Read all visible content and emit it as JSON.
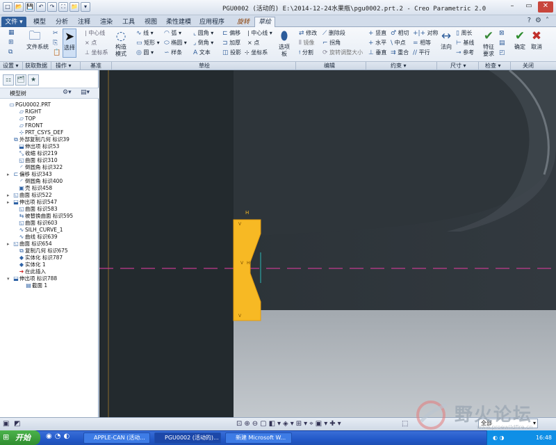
{
  "window": {
    "title": "PGU0002 (活动的) E:\\2014-12-24水果瓶\\pgu0002.prt.2 - Creo Parametric 2.0"
  },
  "quick_access": [
    "□",
    "📂",
    "💾",
    "↶",
    "↷",
    "⛶",
    "📁",
    "▾"
  ],
  "tabs": [
    {
      "label": "文件 ▾",
      "kind": "file"
    },
    {
      "label": "模型"
    },
    {
      "label": "分析"
    },
    {
      "label": "注释"
    },
    {
      "label": "渲染"
    },
    {
      "label": "工具"
    },
    {
      "label": "视图"
    },
    {
      "label": "柔性建模"
    },
    {
      "label": "应用程序"
    },
    {
      "label": "旋转",
      "kind": "ctx"
    },
    {
      "label": "草绘",
      "kind": "active"
    }
  ],
  "ribbon": {
    "setup": {
      "labels": [
        "设置 ▾"
      ]
    },
    "getdata": {
      "file_system": "文件系统",
      "group": "获取数据"
    },
    "operations": {
      "select": "选择",
      "group": "操作 ▾"
    },
    "datum": {
      "centerline": "中心线",
      "point": "点",
      "coordsys": "坐标系",
      "group": "基准"
    },
    "construction": {
      "label": "构造模式"
    },
    "sketch": {
      "line": "线",
      "arc": "弧",
      "fillet": "圆角",
      "offset": "偏移",
      "centerline": "中心线",
      "rectangle": "矩形",
      "ellipse": "椭圆",
      "chamfer": "倒角",
      "thicken": "加厚",
      "point": "点",
      "circle": "圆",
      "spline": "样条",
      "text": "文本",
      "project": "投影",
      "coordsys": "坐标系",
      "palette": "选项板",
      "group": "草绘"
    },
    "editing": {
      "modify": "修改",
      "delete_segment": "删除段",
      "mirror": "镜像",
      "corner": "拐角",
      "divide": "分割",
      "rotate_resize": "旋转调整大小",
      "group": "编辑"
    },
    "constrain": {
      "vertical": "竖直",
      "tangent": "相切",
      "symmetric": "对称",
      "horizontal": "水平",
      "midpoint": "中点",
      "equal": "相等",
      "perpendicular": "垂直",
      "coincident": "重合",
      "parallel": "平行",
      "group": "约束 ▾"
    },
    "dimension": {
      "normal": "法向",
      "perimeter": "周长",
      "baseline": "基线",
      "reference": "参考",
      "group": "尺寸 ▾"
    },
    "inspect": {
      "feature_req": "特征要求",
      "group": "检查 ▾"
    },
    "close": {
      "ok": "确定",
      "cancel": "取消",
      "group": "关闭"
    }
  },
  "model_tree": {
    "title": "模型树",
    "nodes": [
      {
        "label": "PGU0002.PRT",
        "icon": "part-icon",
        "expand": ""
      },
      {
        "label": "RIGHT",
        "icon": "datum-plane-icon",
        "expand": ""
      },
      {
        "label": "TOP",
        "icon": "datum-plane-icon",
        "expand": ""
      },
      {
        "label": "FRONT",
        "icon": "datum-plane-icon",
        "expand": ""
      },
      {
        "label": "PRT_CSYS_DEF",
        "icon": "csys-icon",
        "expand": ""
      },
      {
        "label": "外部复制几何 标识39",
        "icon": "copy-geom-icon",
        "expand": ""
      },
      {
        "label": "伸出项 标识53",
        "icon": "extrude-icon",
        "expand": ""
      },
      {
        "label": "收缩 标识219",
        "icon": "shrink-icon",
        "expand": ""
      },
      {
        "label": "曲面 标识310",
        "icon": "surface-icon",
        "expand": ""
      },
      {
        "label": "倒圆角 标识322",
        "icon": "round-icon",
        "expand": ""
      },
      {
        "label": "偏移 标识343",
        "icon": "offset-icon",
        "expand": "▸"
      },
      {
        "label": "倒圆角 标识400",
        "icon": "round-icon",
        "expand": ""
      },
      {
        "label": "壳 标识458",
        "icon": "shell-icon",
        "expand": ""
      },
      {
        "label": "曲面 标识522",
        "icon": "surface-icon",
        "expand": "▸"
      },
      {
        "label": "伸出项 标识547",
        "icon": "extrude-icon",
        "expand": "▸"
      },
      {
        "label": "曲面 标识583",
        "icon": "surface-icon",
        "expand": ""
      },
      {
        "label": "被替换曲面 标识595",
        "icon": "replace-surface-icon",
        "expand": ""
      },
      {
        "label": "曲面 标识603",
        "icon": "surface-icon",
        "expand": ""
      },
      {
        "label": "SILH_CURVE_1",
        "icon": "curve-icon",
        "expand": ""
      },
      {
        "label": "曲线 标识639",
        "icon": "curve-icon",
        "expand": ""
      },
      {
        "label": "曲面 标识654",
        "icon": "surface-icon",
        "expand": "▸"
      },
      {
        "label": "复制几何 标识675",
        "icon": "copy-geom-icon",
        "expand": ""
      },
      {
        "label": "实体化 标识787",
        "icon": "solidify-icon",
        "expand": ""
      },
      {
        "label": "实体化 1",
        "icon": "solidify-icon",
        "expand": ""
      },
      {
        "label": "在此插入",
        "icon": "insert-here-icon",
        "expand": ""
      },
      {
        "label": "伸出项 标识788",
        "icon": "extrude-icon",
        "expand": "▾"
      },
      {
        "label": "截面 1",
        "icon": "section-icon",
        "expand": ""
      }
    ]
  },
  "viewport": {
    "sketch_labels": [
      "H",
      "V",
      "V",
      "H",
      "V"
    ],
    "colors": {
      "sketch_fill": "#f7b924",
      "centerline": "#c23b8f",
      "background": "#262c31"
    }
  },
  "statusbar": {
    "filter": "全部"
  },
  "taskbar": {
    "start": "开始",
    "items": [
      "APPLE-CAN (活动...",
      "PGU0002 (活动的)...",
      "新建 Microsoft W..."
    ],
    "clock": "16:48"
  },
  "watermark": {
    "text": "野火论坛",
    "url": "www.proewildfire.cn"
  }
}
